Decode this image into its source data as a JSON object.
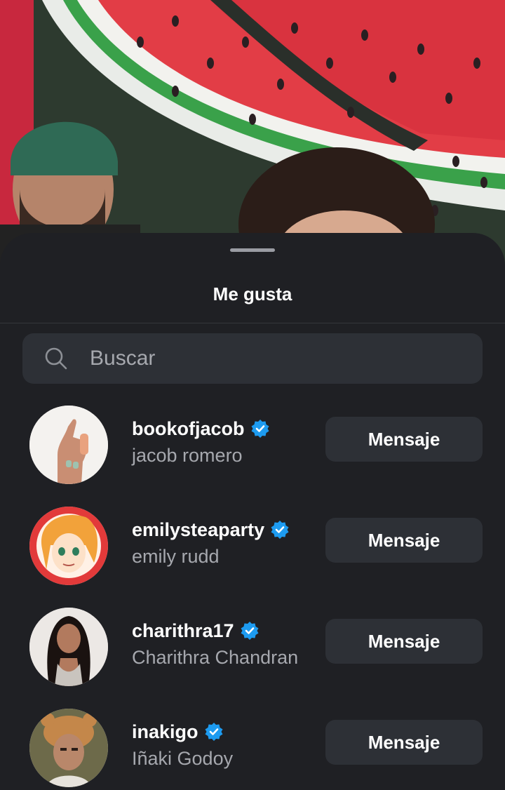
{
  "sheet": {
    "title": "Me gusta"
  },
  "search": {
    "placeholder": "Buscar",
    "icon": "search-icon"
  },
  "colors": {
    "background": "#1f2024",
    "surface": "#2d3036",
    "secondary_text": "#a6a8ae",
    "verified_badge": "#1d9bf0"
  },
  "likes": [
    {
      "username": "bookofjacob",
      "full_name": "jacob romero",
      "verified": true,
      "button_label": "Mensaje"
    },
    {
      "username": "emilysteaparty",
      "full_name": "emily rudd",
      "verified": true,
      "button_label": "Mensaje"
    },
    {
      "username": "charithra17",
      "full_name": "Charithra Chandran",
      "verified": true,
      "button_label": "Mensaje"
    },
    {
      "username": "inakigo",
      "full_name": "Iñaki Godoy",
      "verified": true,
      "button_label": "Mensaje"
    }
  ]
}
